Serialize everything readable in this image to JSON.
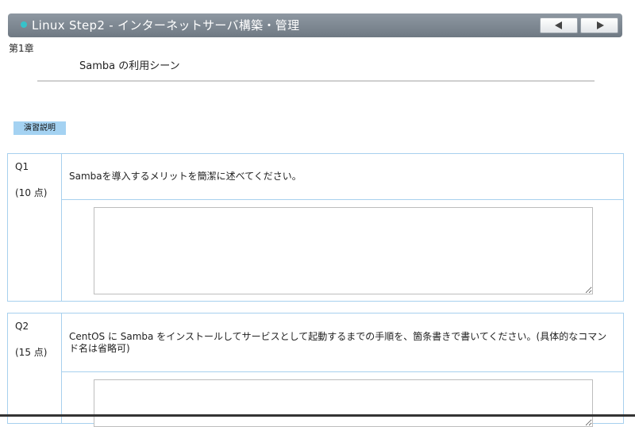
{
  "header": {
    "title": "Linux Step2 - インターネットサーバ構築・管理",
    "prev_icon": "triangle-left-icon",
    "next_icon": "triangle-right-icon"
  },
  "chapter": "第1章",
  "lesson_title": "Samba の利用シーン",
  "exercise_badge": "演習説明",
  "questions": [
    {
      "number": "Q1",
      "points": "(10 点)",
      "text": "Sambaを導入するメリットを簡潔に述べてください。",
      "answer": ""
    },
    {
      "number": "Q2",
      "points": "(15 点)",
      "text": "CentOS に Samba をインストールしてサービスとして起動するまでの手順を、箇条書きで書いてください。(具体的なコマンド名は省略可)",
      "answer": ""
    }
  ],
  "colors": {
    "header_bg": "#7b858f",
    "accent_dot": "#37c2c9",
    "badge_bg": "#a4d2f2",
    "box_border": "#a7d0ee"
  }
}
